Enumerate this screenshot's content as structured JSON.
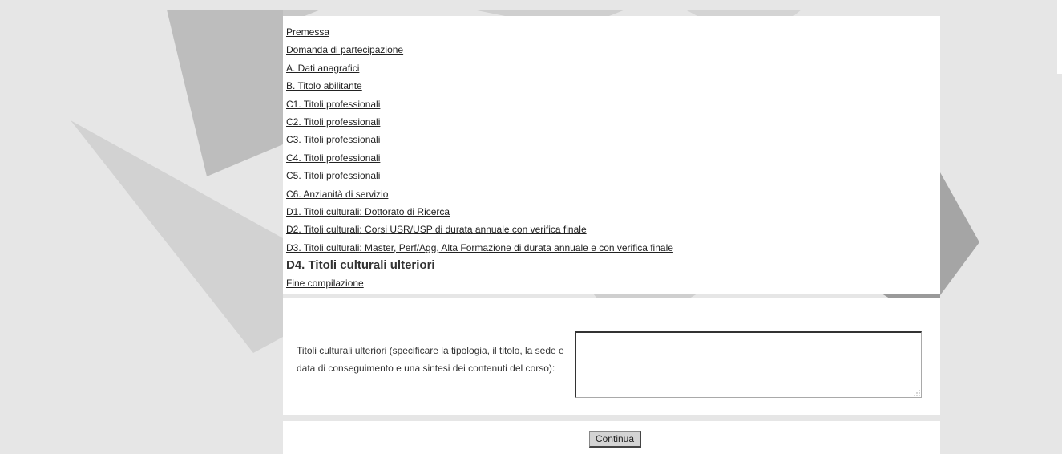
{
  "nav": {
    "items": [
      {
        "label": "Premessa",
        "current": false
      },
      {
        "label": "Domanda di partecipazione",
        "current": false
      },
      {
        "label": "A. Dati anagrafici",
        "current": false
      },
      {
        "label": "B. Titolo abilitante",
        "current": false
      },
      {
        "label": "C1. Titoli professionali",
        "current": false
      },
      {
        "label": "C2. Titoli professionali",
        "current": false
      },
      {
        "label": "C3. Titoli professionali",
        "current": false
      },
      {
        "label": "C4. Titoli professionali",
        "current": false
      },
      {
        "label": "C5. Titoli professionali",
        "current": false
      },
      {
        "label": "C6. Anzianità di servizio",
        "current": false
      },
      {
        "label": "D1. Titoli culturali: Dottorato di Ricerca",
        "current": false
      },
      {
        "label": "D2. Titoli culturali: Corsi USR/USP di durata annuale con verifica finale",
        "current": false
      },
      {
        "label": "D3. Titoli culturali: Master, Perf/Agg, Alta Formazione di durata annuale e con verifica finale",
        "current": false
      },
      {
        "label": "D4. Titoli culturali ulteriori",
        "current": true
      },
      {
        "label": "Fine compilazione",
        "current": false
      }
    ]
  },
  "form": {
    "field_label": "Titoli culturali ulteriori (specificare la tipologia, il titolo, la sede e data di conseguimento e una sintesi dei contenuti del corso):",
    "field_value": "",
    "continue_label": "Continua"
  },
  "colors": {
    "page_background": "#e6e6e6",
    "panel_background": "#ffffff",
    "button_background": "#d4d4d4"
  }
}
